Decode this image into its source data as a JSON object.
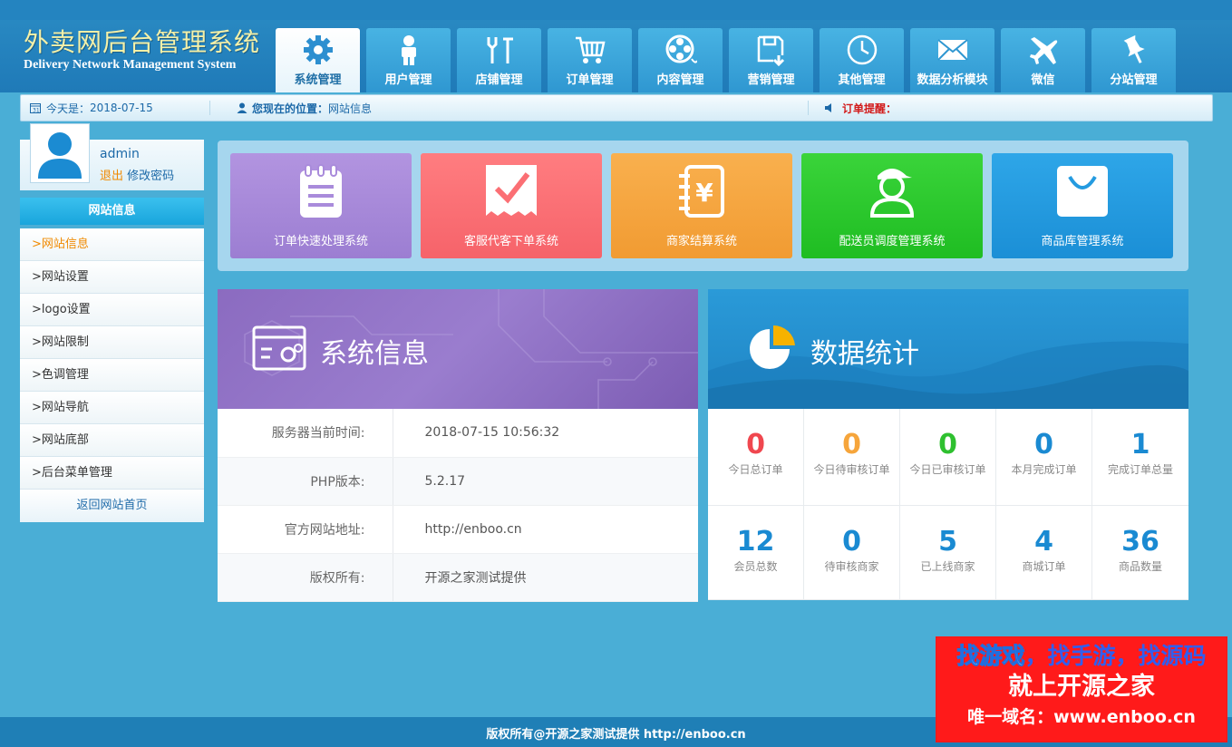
{
  "logo": {
    "cn": "外卖网后台管理系统",
    "en": "Delivery Network Management System"
  },
  "nav": [
    {
      "label": "系统管理",
      "icon": "gear-icon",
      "active": true
    },
    {
      "label": "用户管理",
      "icon": "user-icon",
      "active": false
    },
    {
      "label": "店铺管理",
      "icon": "tools-icon",
      "active": false
    },
    {
      "label": "订单管理",
      "icon": "cart-icon",
      "active": false
    },
    {
      "label": "内容管理",
      "icon": "film-reel-icon",
      "active": false
    },
    {
      "label": "营销管理",
      "icon": "save-disk-icon",
      "active": false
    },
    {
      "label": "其他管理",
      "icon": "clock-icon",
      "active": false
    },
    {
      "label": "数据分析模块",
      "icon": "envelope-icon",
      "active": false
    },
    {
      "label": "微信",
      "icon": "airplane-icon",
      "active": false
    },
    {
      "label": "分站管理",
      "icon": "pin-icon",
      "active": false
    }
  ],
  "infobar": {
    "today_label": "今天是：",
    "today_value": "2018-07-15",
    "location_label": "您现在的位置：",
    "location_value": "网站信息",
    "order_alert_label": "订单提醒："
  },
  "user": {
    "name": "admin",
    "logout": "退出",
    "change_password": "修改密码"
  },
  "sidebar": {
    "title": "网站信息",
    "items": [
      {
        "label": ">网站信息",
        "active": true
      },
      {
        "label": ">网站设置",
        "active": false
      },
      {
        "label": ">logo设置",
        "active": false
      },
      {
        "label": ">网站限制",
        "active": false
      },
      {
        "label": ">色调管理",
        "active": false
      },
      {
        "label": ">网站导航",
        "active": false
      },
      {
        "label": ">网站底部",
        "active": false
      },
      {
        "label": ">后台菜单管理",
        "active": false
      }
    ],
    "back_link": "返回网站首页"
  },
  "tiles": [
    {
      "label": "订单快速处理系统",
      "icon": "notepad-icon",
      "color": "#a98bdb"
    },
    {
      "label": "客服代客下单系统",
      "icon": "receipt-check-icon",
      "color": "#fb6f74"
    },
    {
      "label": "商家结算系统",
      "icon": "yen-notebook-icon",
      "color": "#f7a843"
    },
    {
      "label": "配送员调度管理系统",
      "icon": "courier-icon",
      "color": "#2dc730"
    },
    {
      "label": "商品库管理系统",
      "icon": "shopping-bag-icon",
      "color": "#249be0"
    }
  ],
  "system_info": {
    "title": "系统信息",
    "rows": [
      {
        "key": "服务器当前时间:",
        "value": "2018-07-15 10:56:32"
      },
      {
        "key": "PHP版本:",
        "value": "5.2.17"
      },
      {
        "key": "官方网站地址:",
        "value": "http://enboo.cn"
      },
      {
        "key": "版权所有:",
        "value": "开源之家测试提供"
      }
    ]
  },
  "data_stats": {
    "title": "数据统计",
    "items": [
      {
        "value": "0",
        "label": "今日总订单",
        "color": "#f0474f"
      },
      {
        "value": "0",
        "label": "今日待审核订单",
        "color": "#f6a53b"
      },
      {
        "value": "0",
        "label": "今日已审核订单",
        "color": "#2ec02f"
      },
      {
        "value": "0",
        "label": "本月完成订单",
        "color": "#1a8ad2"
      },
      {
        "value": "1",
        "label": "完成订单总量",
        "color": "#1a8ad2"
      },
      {
        "value": "12",
        "label": "会员总数",
        "color": "#1a8ad2"
      },
      {
        "value": "0",
        "label": "待审核商家",
        "color": "#1a8ad2"
      },
      {
        "value": "5",
        "label": "已上线商家",
        "color": "#1a8ad2"
      },
      {
        "value": "4",
        "label": "商城订单",
        "color": "#1a8ad2"
      },
      {
        "value": "36",
        "label": "商品数量",
        "color": "#1a8ad2"
      }
    ]
  },
  "footer": {
    "text": "版权所有@开源之家测试提供 http://enboo.cn"
  },
  "ad": {
    "line1_part1": "找游戏",
    "line1_part2": "，找手游，找源码",
    "line2": "就上开源之家",
    "line3": "唯一域名：www.enboo.cn"
  }
}
